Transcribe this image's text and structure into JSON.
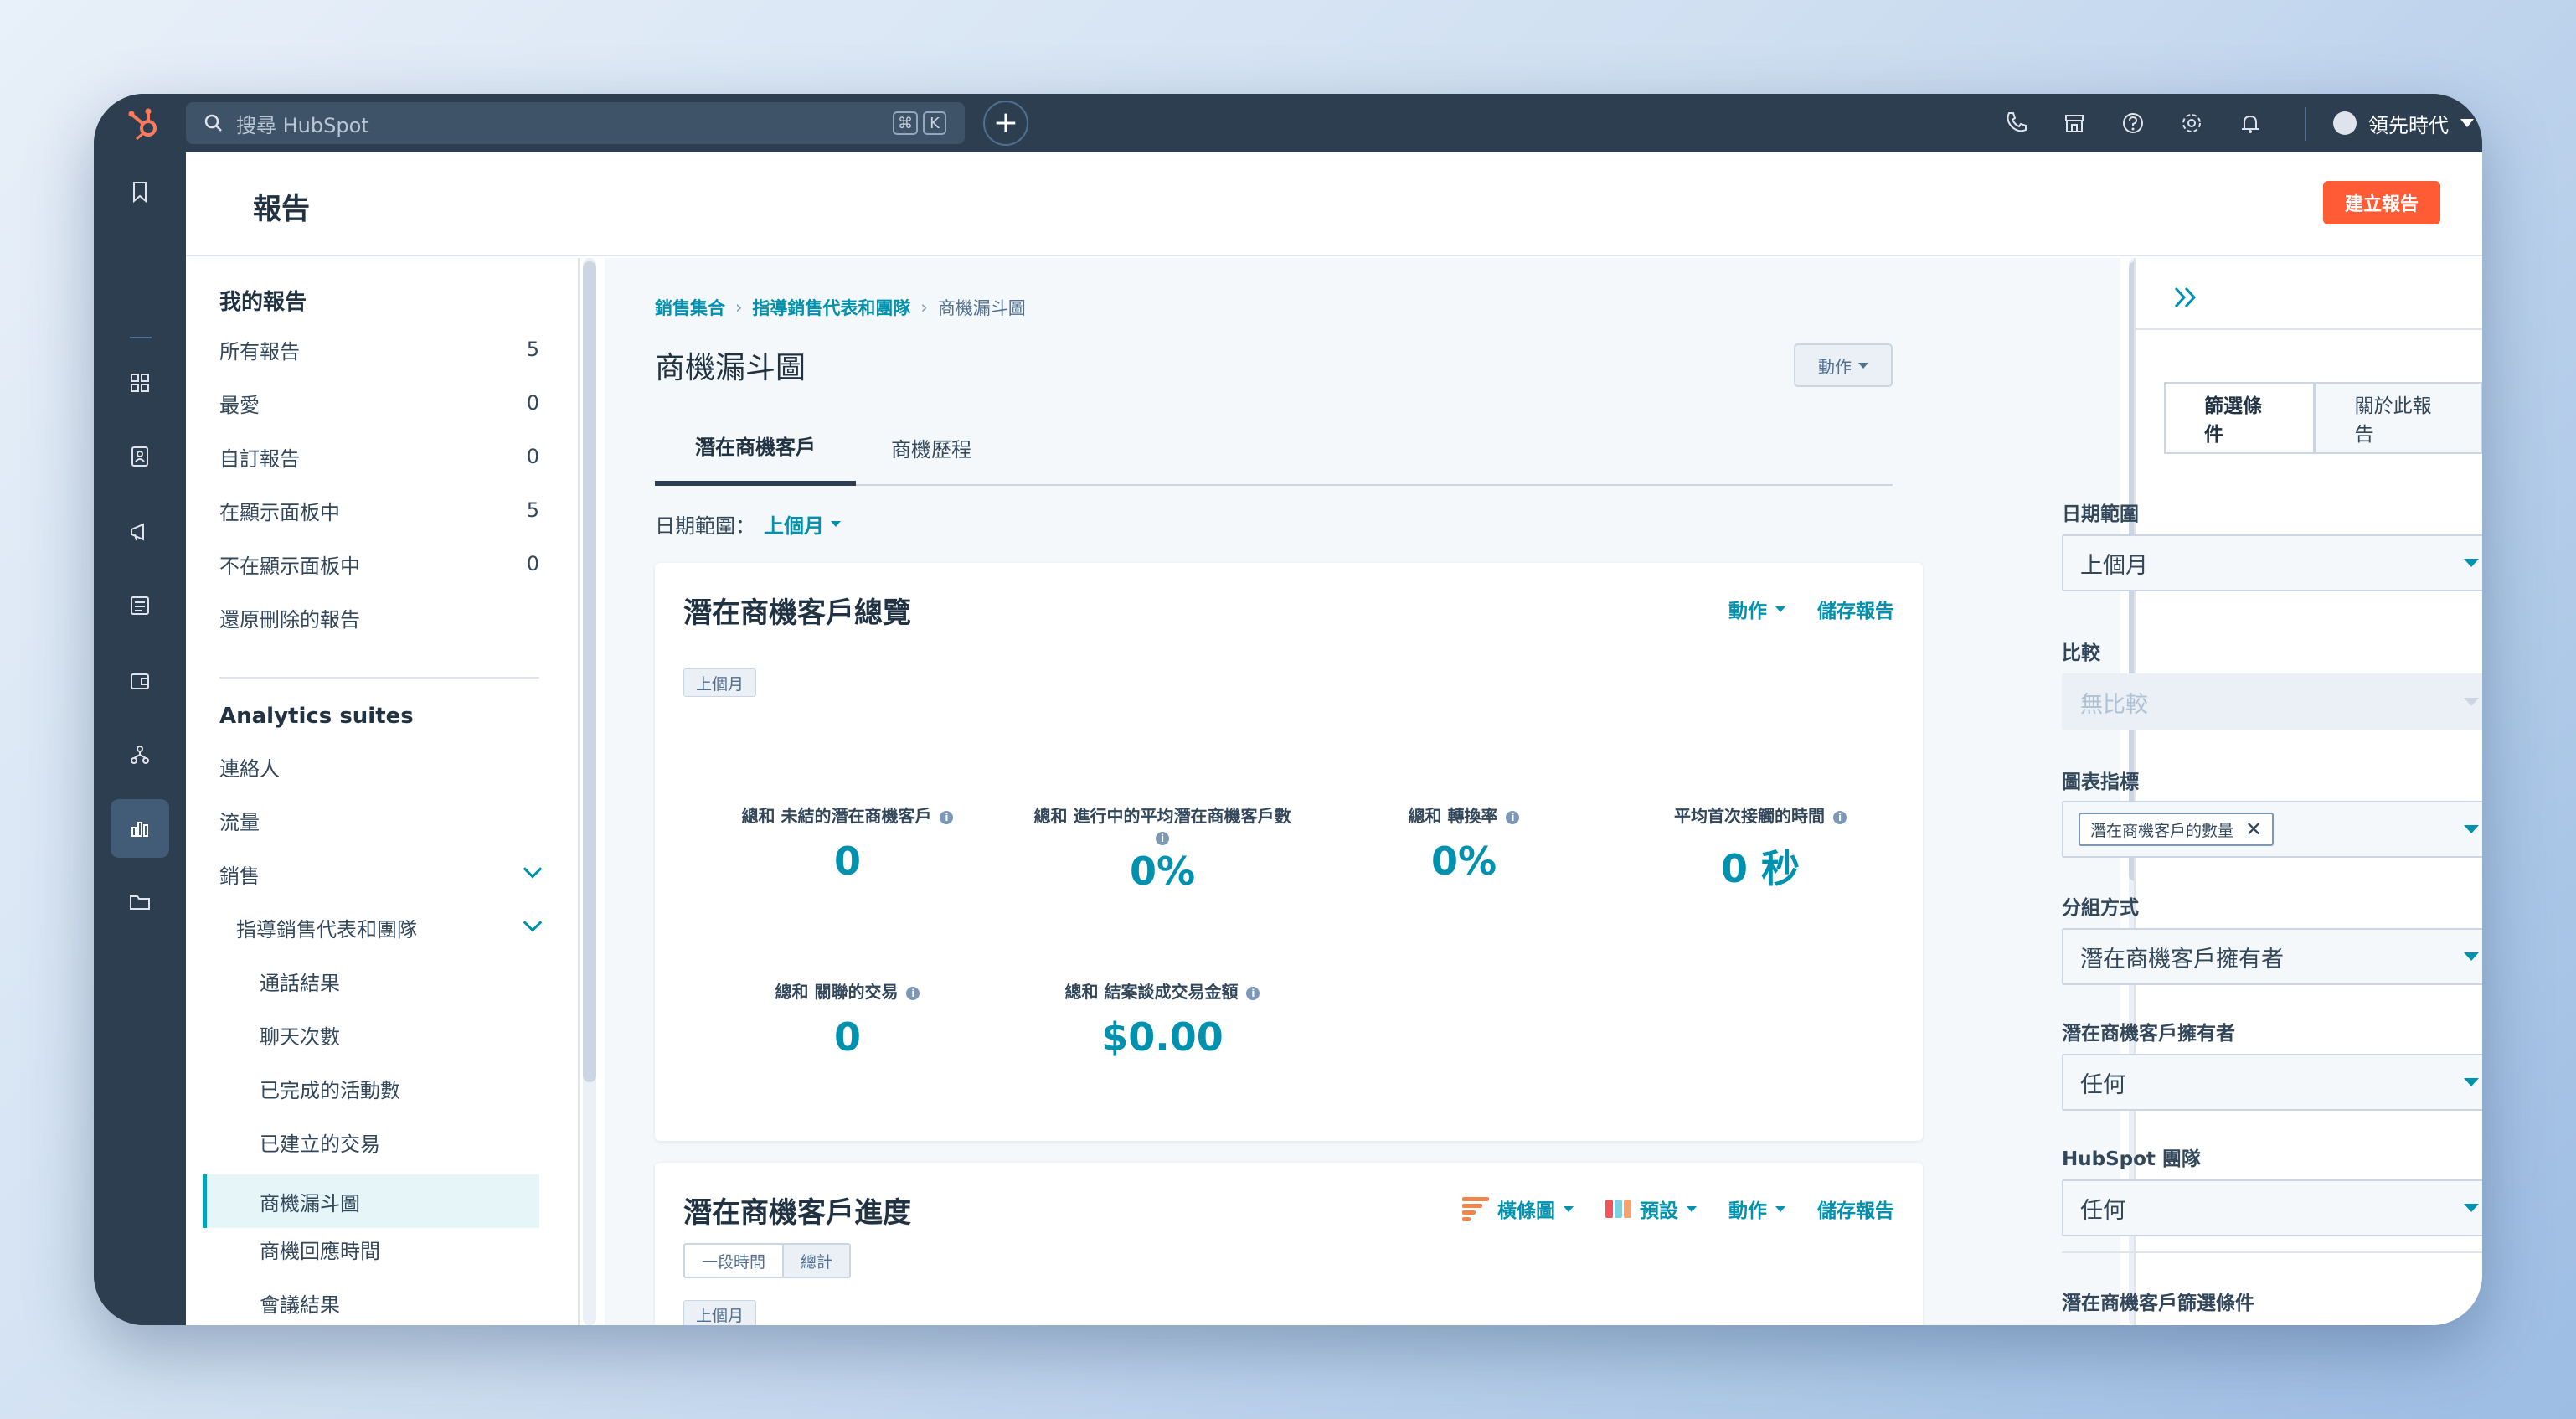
{
  "topbar": {
    "search_placeholder": "搜尋 HubSpot",
    "shortcut_keys": [
      "⌘",
      "K"
    ],
    "add_label": "+",
    "account_name": "領先時代"
  },
  "page": {
    "title": "報告",
    "create_button": "建立報告"
  },
  "sidebar": {
    "my_reports_heading": "我的報告",
    "my_reports": [
      {
        "label": "所有報告",
        "count": "5"
      },
      {
        "label": "最愛",
        "count": "0"
      },
      {
        "label": "自訂報告",
        "count": "0"
      },
      {
        "label": "在顯示面板中",
        "count": "5"
      },
      {
        "label": "不在顯示面板中",
        "count": "0"
      },
      {
        "label": "還原刪除的報告",
        "count": ""
      }
    ],
    "suites_heading": "Analytics suites",
    "suites": [
      "連絡人",
      "流量",
      "銷售"
    ],
    "subgroup": "指導銷售代表和團隊",
    "subitems": [
      "通話結果",
      "聊天次數",
      "已完成的活動數",
      "已建立的交易",
      "商機漏斗圖",
      "商機回應時間",
      "會議結果"
    ],
    "active_item": "商機漏斗圖"
  },
  "content": {
    "breadcrumb": [
      "銷售集合",
      "指導銷售代表和團隊",
      "商機漏斗圖"
    ],
    "title": "商機漏斗圖",
    "actions_label": "動作",
    "tabs": [
      "潛在商機客戶",
      "商機歷程"
    ],
    "date_range_label": "日期範圍：",
    "date_range_value": "上個月",
    "overview": {
      "title": "潛在商機客戶總覽",
      "actions": "動作",
      "save": "儲存報告",
      "tag": "上個月",
      "kpis": [
        {
          "label": "總和 未結的潛在商機客戶",
          "value": "0"
        },
        {
          "label": "總和 進行中的平均潛在商機客戶數",
          "value": "0%"
        },
        {
          "label": "總和 轉換率",
          "value": "0%"
        },
        {
          "label": "平均首次接觸的時間",
          "value": "0 秒"
        },
        {
          "label": "總和 關聯的交易",
          "value": "0"
        },
        {
          "label": "總和 結案談成交易金額",
          "value": "$0.00"
        }
      ]
    },
    "progress": {
      "title": "潛在商機客戶進度",
      "chart_type": "橫條圖",
      "preset": "預設",
      "actions": "動作",
      "save": "儲存報告",
      "segments": [
        "一段時間",
        "總計"
      ],
      "tag": "上個月"
    }
  },
  "right_panel": {
    "tabs": [
      "篩選條件",
      "關於此報告"
    ],
    "fields": {
      "date_range": {
        "label": "日期範圍",
        "value": "上個月"
      },
      "compare": {
        "label": "比較",
        "value": "無比較"
      },
      "metric": {
        "label": "圖表指標",
        "chip": "潛在商機客戶的數量"
      },
      "group_by": {
        "label": "分組方式",
        "value": "潛在商機客戶擁有者"
      },
      "owner": {
        "label": "潛在商機客戶擁有者",
        "value": "任何"
      },
      "team": {
        "label": "HubSpot 團隊",
        "value": "任何"
      }
    },
    "filters_heading": "潛在商機客戶篩選條件"
  },
  "colors": {
    "accent": "#0091ae",
    "brand_orange": "#ff5c35",
    "nav_dark": "#2d3e50"
  },
  "icons": [
    "hubspot-logo-icon",
    "search-icon",
    "phone-icon",
    "marketplace-icon",
    "help-icon",
    "settings-icon",
    "notification-bell-icon",
    "bookmark-icon",
    "grid-icon",
    "contacts-icon",
    "megaphone-icon",
    "content-icon",
    "commerce-icon",
    "automation-icon",
    "reports-icon",
    "folder-icon",
    "collapse-panel-icon",
    "info-icon",
    "close-icon"
  ]
}
